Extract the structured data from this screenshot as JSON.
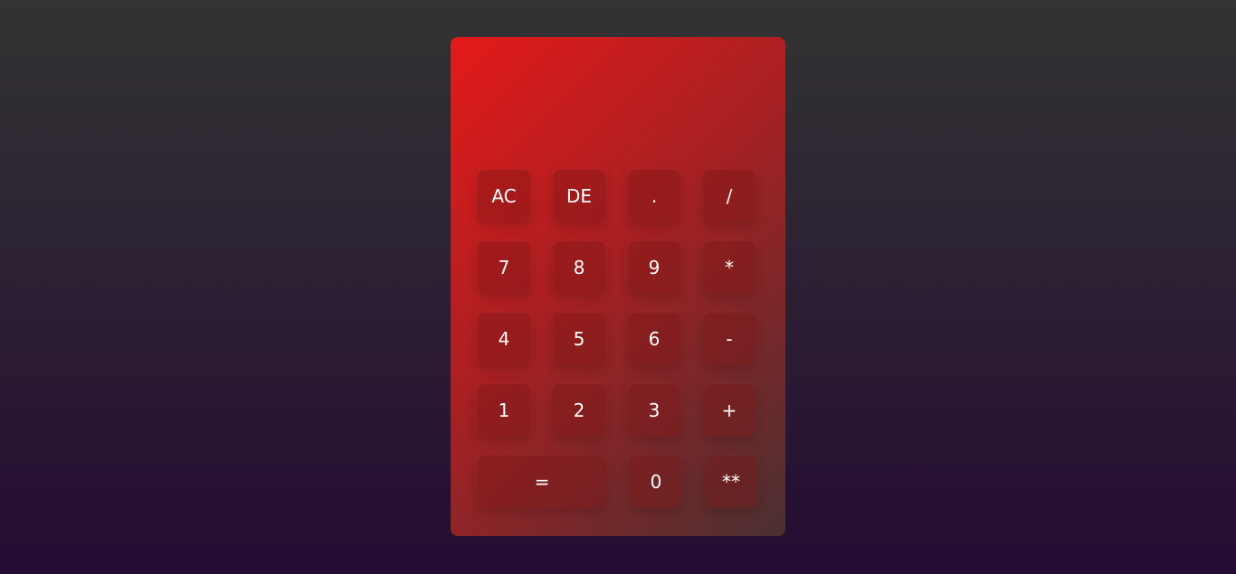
{
  "calculator": {
    "display_value": "",
    "buttons": {
      "ac": "AC",
      "de": "DE",
      "dot": ".",
      "divide": "/",
      "seven": "7",
      "eight": "8",
      "nine": "9",
      "multiply": "*",
      "four": "4",
      "five": "5",
      "six": "6",
      "minus": "-",
      "one": "1",
      "two": "2",
      "three": "3",
      "plus": "+",
      "equals": "=",
      "zero": "0",
      "power": "**"
    }
  },
  "colors": {
    "background_top": "#333333",
    "background_bottom": "#250b33",
    "panel_start": "#e41a1a",
    "panel_end": "#4a3032",
    "text": "#ffffff"
  }
}
